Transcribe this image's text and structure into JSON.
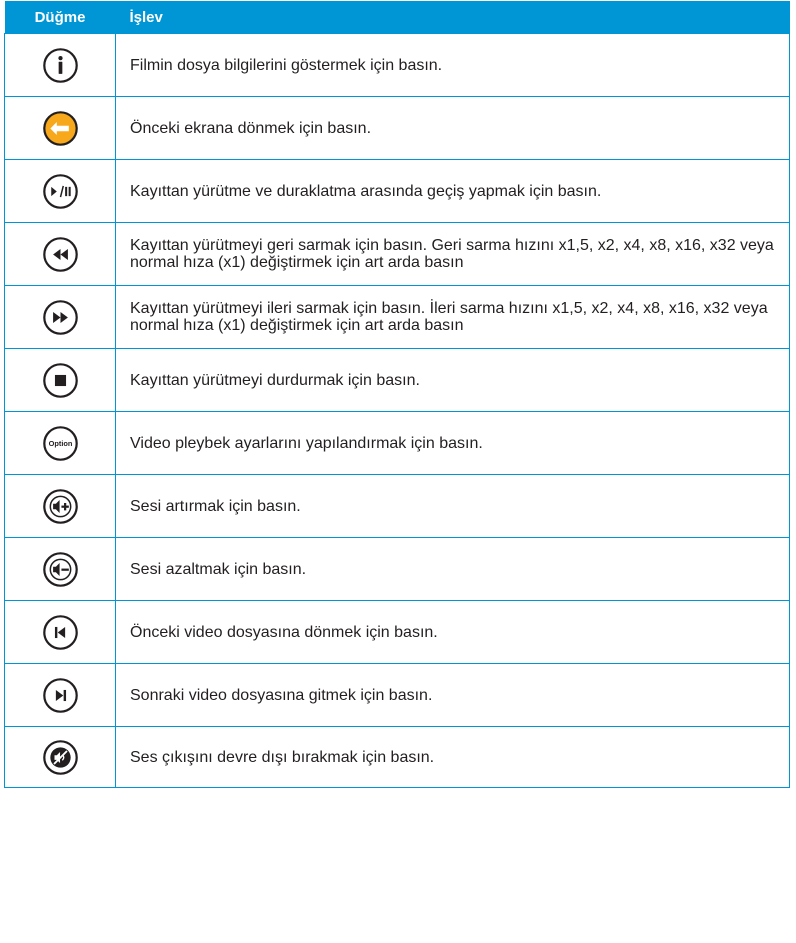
{
  "header": {
    "button_col": "Düğme",
    "function_col": "İşlev"
  },
  "rows": [
    {
      "icon": "info-icon",
      "text": "Filmin dosya bilgilerini göstermek için basın."
    },
    {
      "icon": "back-icon",
      "text": "Önceki ekrana dönmek için basın."
    },
    {
      "icon": "play-pause-icon",
      "text": "Kayıttan yürütme ve duraklatma arasında geçiş yapmak için basın."
    },
    {
      "icon": "rewind-icon",
      "text": "Kayıttan yürütmeyi geri sarmak için basın. Geri sarma hızını x1,5, x2, x4, x8, x16, x32 veya normal hıza (x1) değiştirmek için art arda basın"
    },
    {
      "icon": "fast-forward-icon",
      "text": "Kayıttan yürütmeyi ileri sarmak için basın. İleri sarma hızını x1,5, x2, x4, x8, x16, x32 veya normal hıza (x1) değiştirmek için art arda basın"
    },
    {
      "icon": "stop-icon",
      "text": "Kayıttan yürütmeyi durdurmak için basın."
    },
    {
      "icon": "option-icon",
      "label": "Option",
      "text": "Video pleybek ayarlarını yapılandırmak için basın."
    },
    {
      "icon": "volume-up-icon",
      "text": "Sesi artırmak için basın."
    },
    {
      "icon": "volume-down-icon",
      "text": "Sesi azaltmak için basın."
    },
    {
      "icon": "previous-track-icon",
      "text": "Önceki video dosyasına dönmek için basın."
    },
    {
      "icon": "next-track-icon",
      "text": "Sonraki video dosyasına gitmek için basın."
    },
    {
      "icon": "mute-icon",
      "text": "Ses çıkışını devre dışı bırakmak için basın."
    }
  ],
  "colors": {
    "header_bg": "#0096d6",
    "border": "#0096d6",
    "back_icon_fill": "#f7a81b"
  }
}
